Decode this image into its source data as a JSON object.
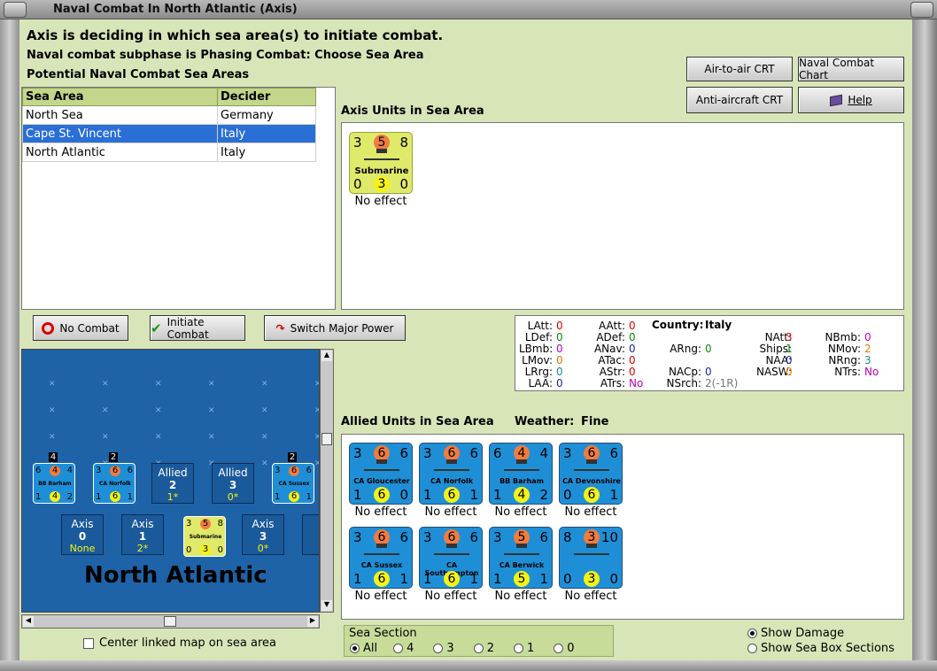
{
  "window": {
    "title": "Naval Combat In North Atlantic (Axis)"
  },
  "status": {
    "line1": "Axis is deciding in which sea area(s) to initiate combat.",
    "line2": "Naval combat subphase is Phasing Combat: Choose Sea Area",
    "line3": "Potential Naval Combat Sea Areas"
  },
  "buttons": {
    "air_crt": "Air-to-air CRT",
    "naval_chart": "Naval Combat Chart",
    "aa_crt": "Anti-aircraft CRT",
    "help": "Help",
    "no_combat": "No Combat",
    "initiate": "Initiate Combat",
    "switch": "Switch Major Power"
  },
  "sea_table": {
    "headers": [
      "Sea Area",
      "Decider"
    ],
    "rows": [
      [
        "North Sea",
        "Germany"
      ],
      [
        "Cape St. Vincent",
        "Italy"
      ],
      [
        "North Atlantic",
        "Italy"
      ]
    ]
  },
  "axis_panel": {
    "title": "Axis Units in Sea Area",
    "unit": {
      "name": "Submarine",
      "tl": "3",
      "tc": "5",
      "tr": "8",
      "bl": "0",
      "bc": "3",
      "br": "0",
      "effect": "No effect"
    }
  },
  "stats": {
    "country_label": "Country:",
    "country": "Italy",
    "LAtt": "0",
    "LDef": "0",
    "LBmb": "0",
    "LMov": "0",
    "LRrg": "0",
    "LAA": "0",
    "AAtt": "0",
    "ADef": "0",
    "ANav": "0",
    "ATac": "0",
    "AStr": "0",
    "ATrs": "No",
    "ARng": "0",
    "NACp": "0",
    "NSrch": "2",
    "NSrch_extra": "(-1R)",
    "NAtt": "3",
    "Ships": "1",
    "NAA": "0",
    "NASW": "0",
    "NBmb": "0",
    "NMov": "2",
    "NRng": "3",
    "NTrs": "No"
  },
  "allied_panel": {
    "title": "Allied Units in Sea Area",
    "weather_label": "Weather:",
    "weather": "Fine",
    "units": [
      {
        "name": "CA Gloucester",
        "tl": "3",
        "tc": "6",
        "tr": "6",
        "bl": "1",
        "bc": "6",
        "br": "0",
        "effect": "No effect"
      },
      {
        "name": "CA Norfolk",
        "tl": "3",
        "tc": "6",
        "tr": "6",
        "bl": "1",
        "bc": "6",
        "br": "1",
        "effect": "No effect"
      },
      {
        "name": "BB Barham",
        "tl": "6",
        "tc": "4",
        "tr": "4",
        "bl": "1",
        "bc": "4",
        "br": "2",
        "effect": "No effect"
      },
      {
        "name": "CA Devonshire",
        "tl": "3",
        "tc": "6",
        "tr": "6",
        "bl": "0",
        "bc": "6",
        "br": "1",
        "effect": "No effect"
      },
      {
        "name": "CA Sussex",
        "tl": "3",
        "tc": "6",
        "tr": "6",
        "bl": "1",
        "bc": "6",
        "br": "1",
        "effect": "No effect"
      },
      {
        "name": "CA Southampton",
        "tl": "3",
        "tc": "6",
        "tr": "6",
        "bl": "1",
        "bc": "6",
        "br": "1",
        "effect": "No effect"
      },
      {
        "name": "CA Berwick",
        "tl": "3",
        "tc": "5",
        "tr": "6",
        "bl": "1",
        "bc": "5",
        "br": "1",
        "effect": "No effect"
      },
      {
        "name": "",
        "tl": "8",
        "tc": "3",
        "tr": "10",
        "bl": "0",
        "bc": "3",
        "br": "0",
        "effect": "No effect"
      }
    ]
  },
  "map": {
    "name": "North Atlantic",
    "allied_boxes": [
      {
        "label": "Allied",
        "num": "2",
        "sub": "1*"
      },
      {
        "label": "Allied",
        "num": "3",
        "sub": "0*"
      }
    ],
    "axis_boxes": [
      {
        "label": "Axis",
        "num": "0",
        "sub": "None"
      },
      {
        "label": "Axis",
        "num": "1",
        "sub": "2*"
      },
      {
        "label": "Axis",
        "num": "3",
        "sub": "0*"
      },
      {
        "label": "A",
        "num": "",
        "sub": ""
      }
    ],
    "counters": [
      {
        "name": "BB Barham",
        "tl": "6",
        "tc": "4",
        "tr": "4",
        "bl": "1",
        "bc": "4",
        "br": "2",
        "flag": "4"
      },
      {
        "name": "CA Norfolk",
        "tl": "3",
        "tc": "6",
        "tr": "6",
        "bl": "1",
        "bc": "6",
        "br": "1",
        "flag": "2"
      },
      {
        "name": "CA Sussex",
        "tl": "3",
        "tc": "6",
        "tr": "6",
        "bl": "1",
        "bc": "6",
        "br": "1",
        "flag": "2"
      },
      {
        "name": "Submarine",
        "tl": "3",
        "tc": "5",
        "tr": "8",
        "bl": "0",
        "bc": "3",
        "br": "0",
        "flag": ""
      }
    ],
    "center_label": "Center linked map on sea area"
  },
  "sea_section": {
    "title": "Sea Section",
    "options": [
      "All",
      "4",
      "3",
      "2",
      "1",
      "0"
    ],
    "selected": "All"
  },
  "display": {
    "show_damage": "Show Damage",
    "show_boxes": "Show Sea Box Sections"
  },
  "colors": {
    "client_bg": "#d8e5b8",
    "allied": "#1e8fd6",
    "axis": "#dfe96a",
    "selection": "#2a6fd6"
  }
}
